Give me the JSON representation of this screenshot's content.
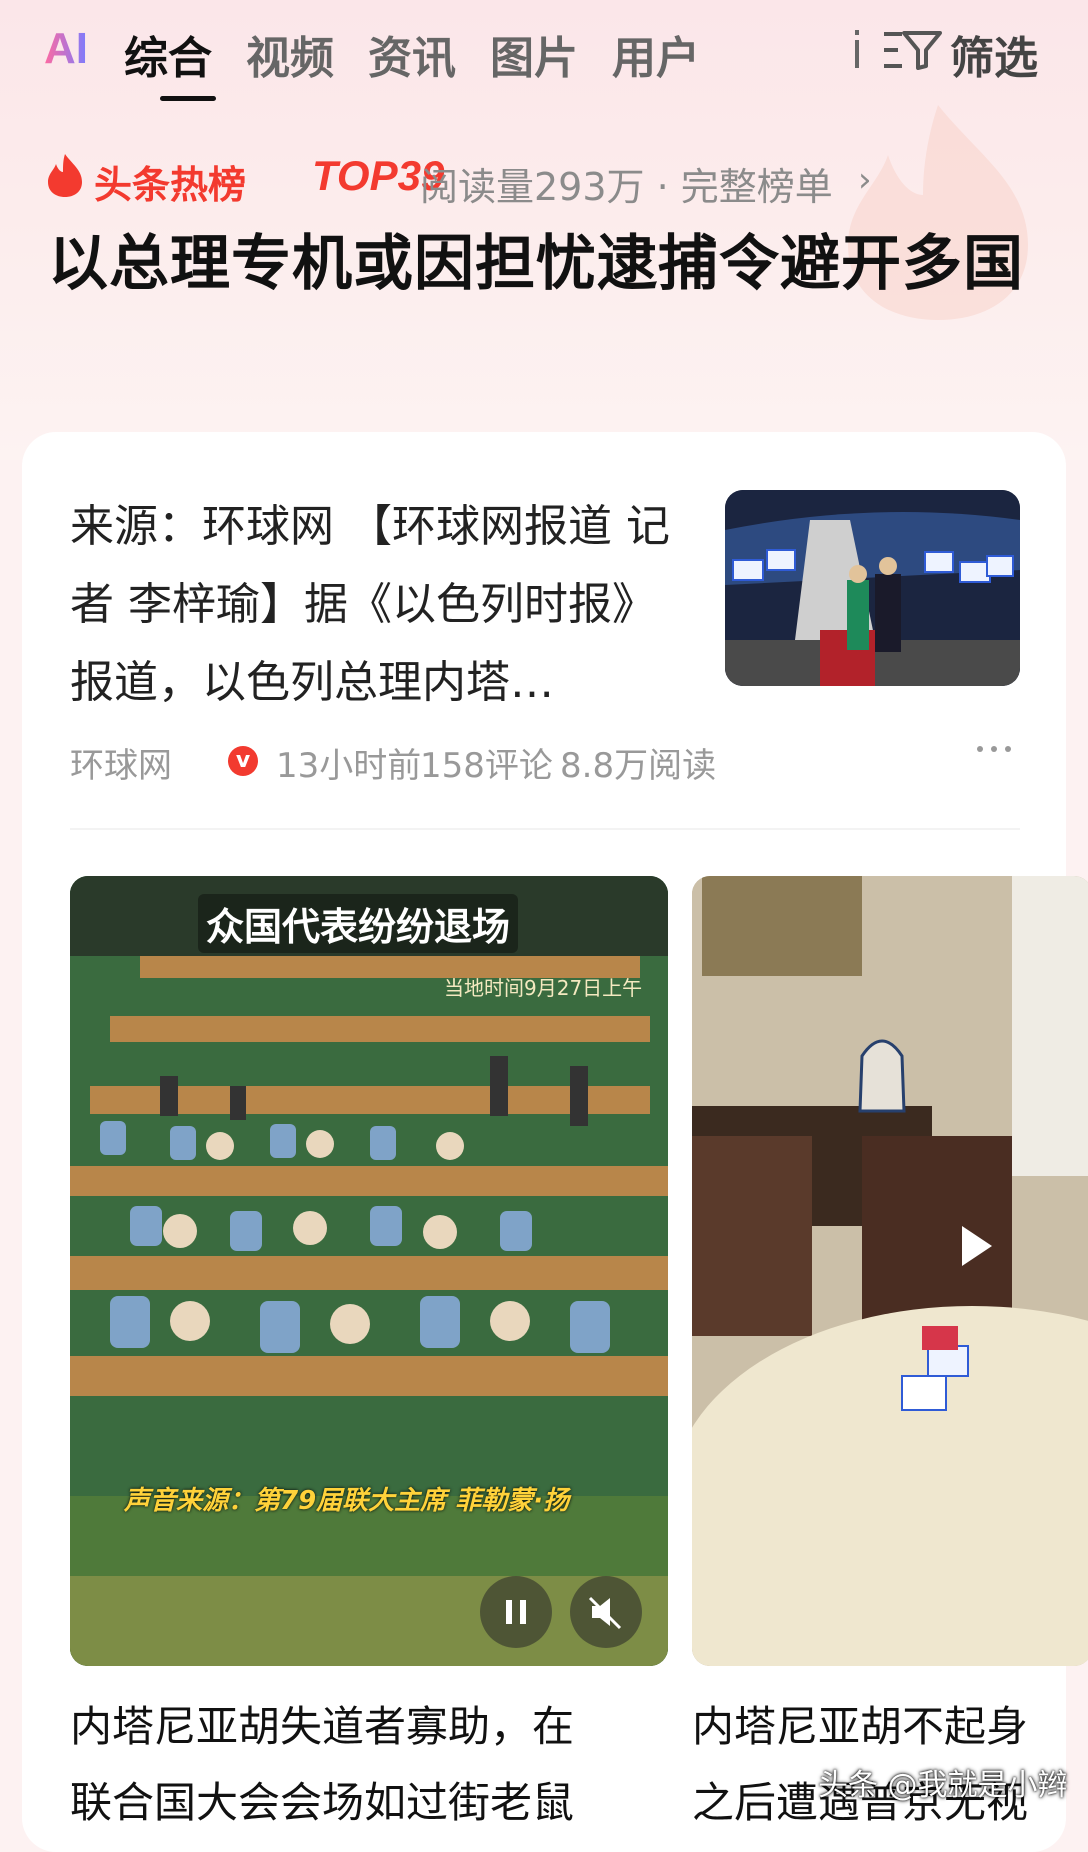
{
  "nav": {
    "ai_label": "AI",
    "tabs": [
      {
        "label": "综合",
        "active": true
      },
      {
        "label": "视频",
        "active": false
      },
      {
        "label": "资讯",
        "active": false
      },
      {
        "label": "图片",
        "active": false
      },
      {
        "label": "用户",
        "active": false
      }
    ],
    "filter_label": "筛选"
  },
  "hot": {
    "title": "头条热榜",
    "rank": "TOP39",
    "meta": "阅读量293万 · 完整榜单",
    "chevron": "›",
    "headline": "以总理专机或因担忧逮捕令避开多国"
  },
  "article": {
    "text": "来源：环球网 【环球网报道 记者 李梓瑜】据《以色列时报》报道，以色列总理内塔…",
    "source": "环球网",
    "verified_badge": "v",
    "time": "13小时前",
    "comments": "158评论",
    "reads": "8.8万阅读"
  },
  "videos": [
    {
      "overlay_top": "众国代表纷纷退场",
      "overlay_time": "当地时间9月27日上午",
      "overlay_bottom": "声音来源：第79届联大主席 菲勒蒙·扬",
      "caption_line1": "内塔尼亚胡失道者寡助，在",
      "caption_line2": "联合国大会会场如过街老鼠"
    },
    {
      "caption_line1": "内塔尼亚胡不起身",
      "caption_line2": "之后遭遇普京无视"
    }
  ],
  "watermark": "头条 @我就是小辫",
  "colors": {
    "accent_red": "#f33a2f",
    "text_dark": "#111111",
    "muted": "#999999"
  }
}
